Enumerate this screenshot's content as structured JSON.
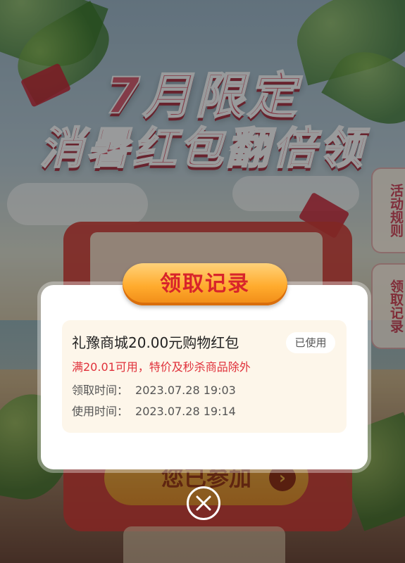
{
  "background": {
    "headline_line1": "7月限定",
    "headline_line2": "消暑红包翻倍领",
    "side_tabs": {
      "rules": "活动规则",
      "records": "领取记录"
    },
    "join_button": "您已参加",
    "join_arrow_icon": "chevron-right-icon"
  },
  "modal": {
    "title": "领取记录",
    "record": {
      "title": "礼豫商城20.00元购物红包",
      "status": "已使用",
      "condition": "满20.01可用，特价及秒杀商品除外",
      "receive_label": "领取时间：",
      "receive_time": "2023.07.28 19:03",
      "use_label": "使用时间：",
      "use_time": "2023.07.28 19:14"
    },
    "close_icon": "close-icon"
  },
  "colors": {
    "title_text": "#d8242b",
    "title_button": "#ffab2d",
    "condition_text": "#e0303a",
    "card_bg": "#fdf6ea"
  }
}
